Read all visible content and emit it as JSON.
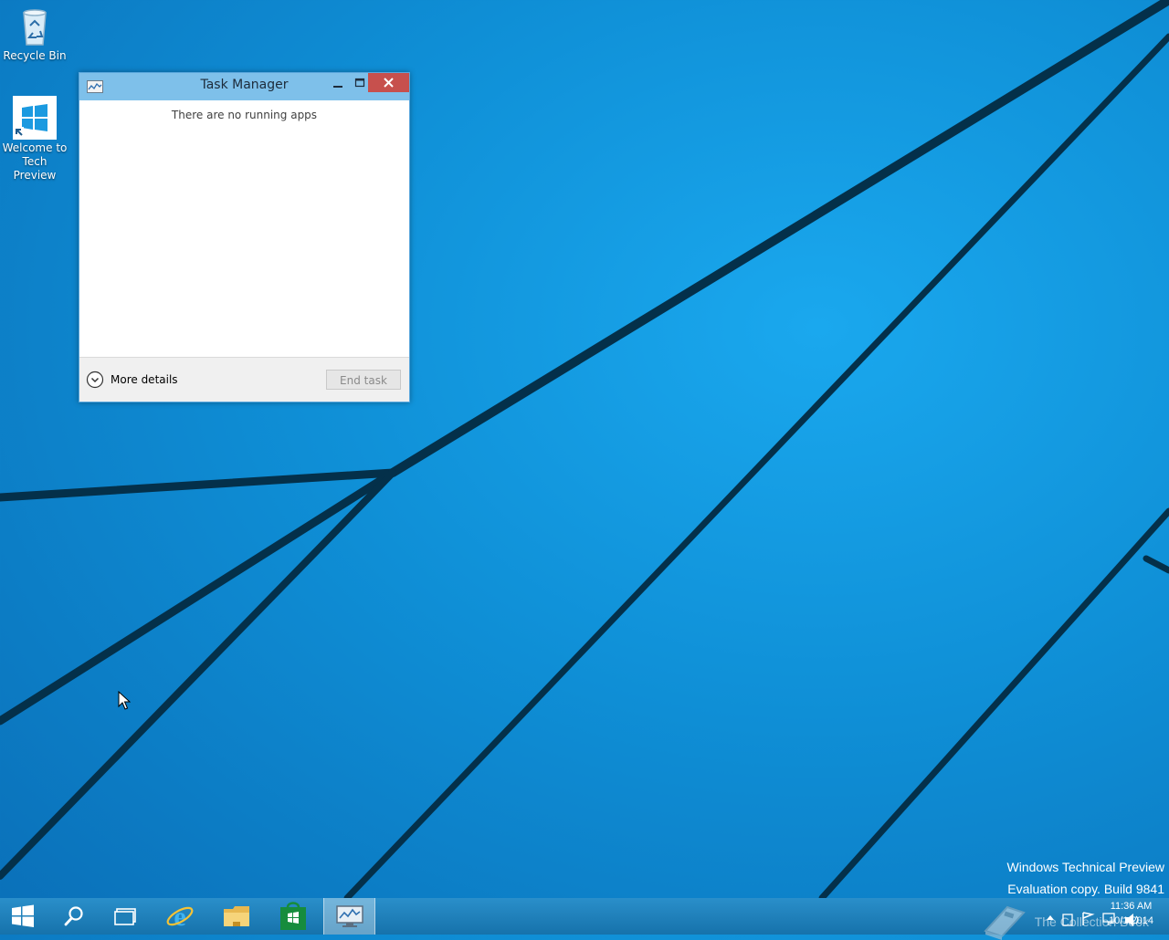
{
  "desktop": {
    "icons": [
      {
        "label": "Recycle Bin",
        "icon": "recycle-bin-icon"
      },
      {
        "label": "Welcome to Tech Preview",
        "label_line1": "Welcome to",
        "label_line2": "Tech Preview",
        "icon": "windows-logo-icon"
      }
    ]
  },
  "task_manager": {
    "title": "Task Manager",
    "empty_message": "There are no running apps",
    "more_details_label": "More details",
    "end_task_label": "End task",
    "end_task_enabled": false
  },
  "watermark": {
    "line1": "Windows Technical Preview",
    "line2": "Evaluation copy. Build 9841",
    "line3": "The Collection Book"
  },
  "taskbar": {
    "buttons": [
      {
        "name": "start-button",
        "icon": "windows-logo-icon"
      },
      {
        "name": "search-button",
        "icon": "search-icon"
      },
      {
        "name": "task-view-button",
        "icon": "task-view-icon"
      },
      {
        "name": "internet-explorer-button",
        "icon": "internet-explorer-icon"
      },
      {
        "name": "file-explorer-button",
        "icon": "folder-icon"
      },
      {
        "name": "store-button",
        "icon": "store-icon"
      },
      {
        "name": "task-manager-button",
        "icon": "task-manager-icon",
        "active": true
      }
    ],
    "clock": {
      "time": "11:36 AM",
      "date": "10/1/2014"
    }
  },
  "colors": {
    "desktop_blue": "#0f8fd6",
    "title_bar": "#7ec0ea",
    "close_button": "#c7504d",
    "taskbar": "#1f7fb8"
  }
}
